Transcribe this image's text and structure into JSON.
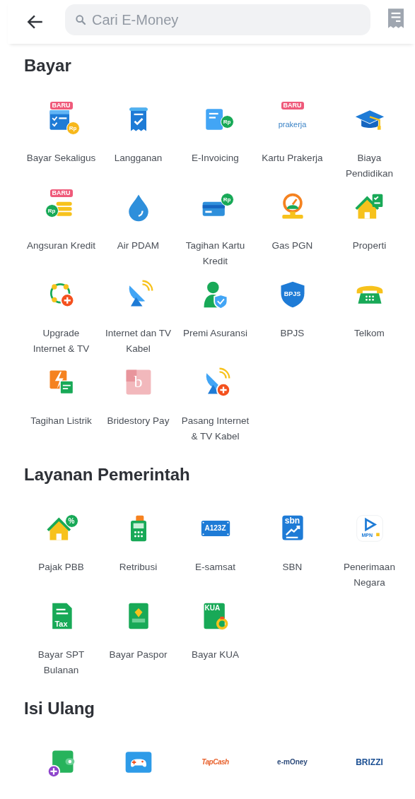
{
  "header": {
    "search": {
      "placeholder": "Cari E-Money"
    }
  },
  "sections": [
    {
      "title": "Bayar",
      "items": [
        {
          "kind": "checklist-card",
          "icon_text": "Rp",
          "badge": "BARU",
          "label": "Bayar Sekaligus"
        },
        {
          "kind": "receipt",
          "label": "Langganan"
        },
        {
          "kind": "invoice",
          "icon_text": "Rp",
          "label": "E-Invoicing"
        },
        {
          "kind": "script-wordmark",
          "icon_text": "prakerja",
          "badge": "BARU",
          "label": "Kartu Prakerja"
        },
        {
          "kind": "graduation-cap",
          "label": "Biaya Pendidikan"
        },
        {
          "kind": "coin-stack",
          "icon_text": "Rp",
          "badge": "BARU",
          "label": "Angsuran Kredit"
        },
        {
          "kind": "water-drop",
          "label": "Air PDAM"
        },
        {
          "kind": "card-coin",
          "icon_text": "Rp",
          "label": "Tagihan Kartu Kredit"
        },
        {
          "kind": "gauge",
          "label": "Gas PGN"
        },
        {
          "kind": "house-checklist",
          "label": "Properti"
        },
        {
          "kind": "network-plus",
          "label": "Upgrade Internet & TV"
        },
        {
          "kind": "satellite-dish",
          "label": "Internet dan TV Kabel"
        },
        {
          "kind": "person-shield",
          "label": "Premi Asuransi"
        },
        {
          "kind": "shield",
          "icon_text": "BPJS",
          "label": "BPJS"
        },
        {
          "kind": "telephone",
          "label": "Telkom"
        },
        {
          "kind": "bolt-document",
          "label": "Tagihan Listrik"
        },
        {
          "kind": "letter-tile",
          "icon_text": "b",
          "label": "Bridestory Pay"
        },
        {
          "kind": "dish-plus",
          "label": "Pasang Internet & TV Kabel"
        }
      ]
    },
    {
      "title": "Layanan Pemerintah",
      "items": [
        {
          "kind": "house-percent",
          "icon_text": "%",
          "label": "Pajak PBB"
        },
        {
          "kind": "payment-terminal",
          "label": "Retribusi"
        },
        {
          "kind": "license-plate",
          "icon_text": "A123Z",
          "label": "E-samsat"
        },
        {
          "kind": "chart-tile",
          "icon_text": "sbn",
          "label": "SBN"
        },
        {
          "kind": "play-tile",
          "icon_text": "MPN",
          "label": "Penerimaan Negara"
        },
        {
          "kind": "green-document",
          "icon_text": "Tax",
          "label": "Bayar SPT Bulanan"
        },
        {
          "kind": "passport",
          "label": "Bayar Paspor"
        },
        {
          "kind": "ring-document",
          "icon_text": "KUA",
          "label": "Bayar KUA"
        }
      ]
    },
    {
      "title": "Isi Ulang",
      "items": [
        {
          "kind": "wallet-plus"
        },
        {
          "kind": "gamepad"
        },
        {
          "kind": "italic-wordmark",
          "icon_text": "TapCash"
        },
        {
          "kind": "round-wordmark",
          "icon_text": "e-mOney"
        },
        {
          "kind": "bold-wordmark",
          "icon_text": "BRIZZI"
        }
      ]
    }
  ]
}
